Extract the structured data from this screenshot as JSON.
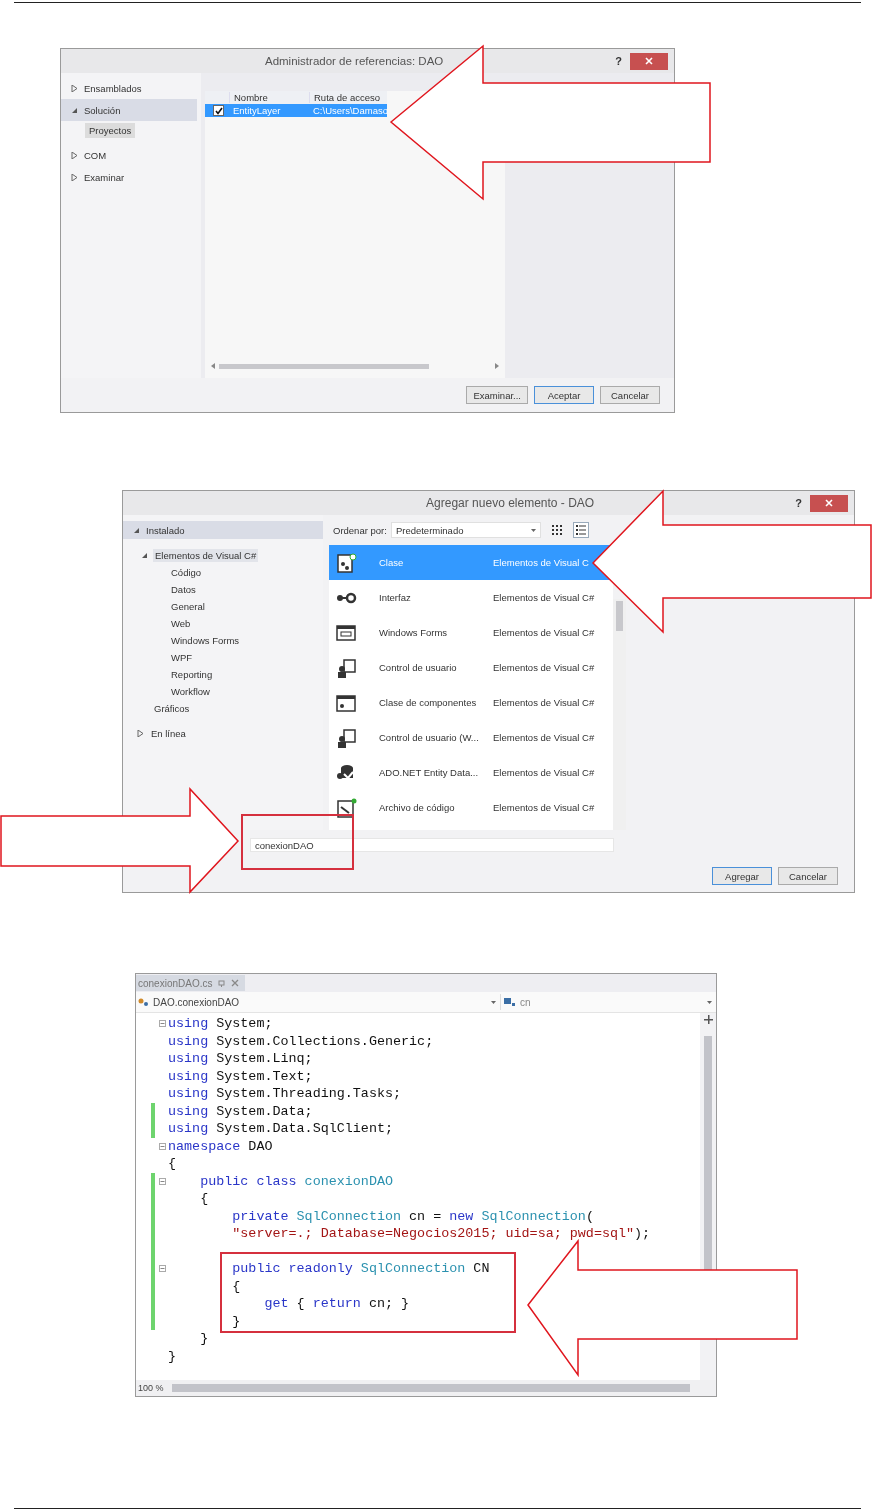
{
  "reference_manager": {
    "title": "Administrador de referencias: DAO",
    "help_label": "?",
    "sidebar": [
      {
        "label": "Ensamblados",
        "expanded": false,
        "selected": false
      },
      {
        "label": "Solución",
        "expanded": true,
        "selected": true,
        "children": [
          {
            "label": "Proyectos",
            "selected": true
          }
        ]
      },
      {
        "label": "COM",
        "expanded": false,
        "selected": false
      },
      {
        "label": "Examinar",
        "expanded": false,
        "selected": false
      }
    ],
    "table": {
      "columns": [
        "Nombre",
        "Ruta de acceso"
      ],
      "rows": [
        {
          "checked": true,
          "selected": true,
          "cells": [
            "EntityLayer",
            "C:\\Users\\Damaso"
          ]
        }
      ]
    },
    "buttons": [
      {
        "label": "Examinar...",
        "default": false
      },
      {
        "label": "Aceptar",
        "default": true
      },
      {
        "label": "Cancelar",
        "default": false
      }
    ]
  },
  "add_item": {
    "title": "Agregar nuevo elemento - DAO",
    "help_label": "?",
    "tree": [
      {
        "label": "Instalado",
        "expanded": true,
        "selected": false,
        "children": [
          {
            "label": "Elementos de Visual C#",
            "expanded": true,
            "selected": true,
            "children": [
              {
                "label": "Código",
                "selected": false
              },
              {
                "label": "Datos",
                "selected": false
              },
              {
                "label": "General",
                "selected": false
              },
              {
                "label": "Web",
                "selected": false
              },
              {
                "label": "Windows Forms",
                "selected": false
              },
              {
                "label": "WPF",
                "selected": false
              },
              {
                "label": "Reporting",
                "selected": false
              },
              {
                "label": "Workflow",
                "selected": false
              }
            ]
          },
          {
            "label": "Gráficos",
            "selected": false
          }
        ]
      },
      {
        "label": "En línea",
        "expanded": false,
        "selected": false
      }
    ],
    "sort": {
      "label": "Ordenar por:",
      "value": "Predeterminado"
    },
    "views": [
      {
        "kind": "grid",
        "selected": false
      },
      {
        "kind": "list",
        "selected": true
      }
    ],
    "templates": [
      {
        "kind": "class",
        "name": "Clase",
        "category": "Elementos de Visual C",
        "selected": true
      },
      {
        "kind": "interface",
        "name": "Interfaz",
        "category": "Elementos de Visual C#",
        "selected": false
      },
      {
        "kind": "form",
        "name": "Windows Forms",
        "category": "Elementos de Visual C#",
        "selected": false
      },
      {
        "kind": "user",
        "name": "Control de usuario",
        "category": "Elementos de Visual C#",
        "selected": false
      },
      {
        "kind": "component",
        "name": "Clase de componentes",
        "category": "Elementos de Visual C#",
        "selected": false
      },
      {
        "kind": "user",
        "name": "Control de usuario (W...",
        "category": "Elementos de Visual C#",
        "selected": false
      },
      {
        "kind": "entity",
        "name": "ADO.NET Entity Data...",
        "category": "Elementos de Visual C#",
        "selected": false
      },
      {
        "kind": "codefile",
        "name": "Archivo de código",
        "category": "Elementos de Visual C#",
        "selected": false
      }
    ],
    "name_field": {
      "value": "conexionDAO"
    },
    "buttons": [
      {
        "label": "Agregar",
        "default": true
      },
      {
        "label": "Cancelar",
        "default": false
      }
    ]
  },
  "editor": {
    "tab": {
      "label": "conexionDAO.cs"
    },
    "type_selector": "DAO.conexionDAO",
    "member_selector": "cn",
    "zoom": "100 %",
    "lines": [
      {
        "fold": true,
        "changed": false,
        "tokens": [
          {
            "kind": "keyword",
            "text": "using"
          },
          {
            "kind": "plain",
            "text": " System;"
          }
        ]
      },
      {
        "fold": false,
        "changed": false,
        "tokens": [
          {
            "kind": "keyword",
            "text": "using"
          },
          {
            "kind": "plain",
            "text": " System.Collections.Generic;"
          }
        ]
      },
      {
        "fold": false,
        "changed": false,
        "tokens": [
          {
            "kind": "keyword",
            "text": "using"
          },
          {
            "kind": "plain",
            "text": " System.Linq;"
          }
        ]
      },
      {
        "fold": false,
        "changed": false,
        "tokens": [
          {
            "kind": "keyword",
            "text": "using"
          },
          {
            "kind": "plain",
            "text": " System.Text;"
          }
        ]
      },
      {
        "fold": false,
        "changed": false,
        "tokens": [
          {
            "kind": "keyword",
            "text": "using"
          },
          {
            "kind": "plain",
            "text": " System.Threading.Tasks;"
          }
        ]
      },
      {
        "fold": false,
        "changed": true,
        "tokens": [
          {
            "kind": "keyword",
            "text": "using"
          },
          {
            "kind": "plain",
            "text": " System.Data;"
          }
        ]
      },
      {
        "fold": false,
        "changed": true,
        "tokens": [
          {
            "kind": "keyword",
            "text": "using"
          },
          {
            "kind": "plain",
            "text": " System.Data.SqlClient;"
          }
        ]
      },
      {
        "fold": true,
        "changed": false,
        "tokens": [
          {
            "kind": "keyword",
            "text": "namespace"
          },
          {
            "kind": "plain",
            "text": " DAO"
          }
        ]
      },
      {
        "fold": false,
        "changed": false,
        "tokens": [
          {
            "kind": "plain",
            "text": "{"
          }
        ]
      },
      {
        "fold": true,
        "changed": true,
        "tokens": [
          {
            "kind": "keyword",
            "text": "    public class"
          },
          {
            "kind": "type",
            "text": " conexionDAO"
          }
        ]
      },
      {
        "fold": false,
        "changed": true,
        "tokens": [
          {
            "kind": "plain",
            "text": "    {"
          }
        ]
      },
      {
        "fold": false,
        "changed": true,
        "tokens": [
          {
            "kind": "keyword",
            "text": "        private"
          },
          {
            "kind": "type",
            "text": " SqlConnection"
          },
          {
            "kind": "plain",
            "text": " cn = "
          },
          {
            "kind": "keyword",
            "text": "new"
          },
          {
            "kind": "type",
            "text": " SqlConnection"
          },
          {
            "kind": "plain",
            "text": "("
          }
        ]
      },
      {
        "fold": false,
        "changed": true,
        "tokens": [
          {
            "kind": "string",
            "text": "        \"server=.; Database=Negocios2015; uid=sa; pwd=sql\""
          },
          {
            "kind": "plain",
            "text": ");"
          }
        ]
      },
      {
        "fold": false,
        "changed": true
      },
      {
        "fold": true,
        "changed": true,
        "tokens": [
          {
            "kind": "keyword",
            "text": "        public readonly"
          },
          {
            "kind": "type",
            "text": " SqlConnection"
          },
          {
            "kind": "plain",
            "text": " CN"
          }
        ]
      },
      {
        "fold": false,
        "changed": true,
        "tokens": [
          {
            "kind": "plain",
            "text": "        {"
          }
        ]
      },
      {
        "fold": false,
        "changed": true,
        "tokens": [
          {
            "kind": "keyword",
            "text": "            get"
          },
          {
            "kind": "plain",
            "text": " { "
          },
          {
            "kind": "keyword",
            "text": "return"
          },
          {
            "kind": "plain",
            "text": " cn; }"
          }
        ]
      },
      {
        "fold": false,
        "changed": true,
        "tokens": [
          {
            "kind": "plain",
            "text": "        }"
          }
        ]
      },
      {
        "fold": false,
        "changed": false,
        "tokens": [
          {
            "kind": "plain",
            "text": "    }"
          }
        ]
      },
      {
        "fold": false,
        "changed": false,
        "tokens": [
          {
            "kind": "plain",
            "text": "}"
          }
        ]
      }
    ]
  }
}
